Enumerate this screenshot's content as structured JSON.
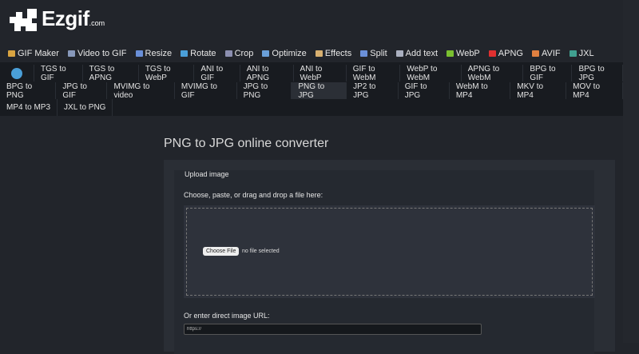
{
  "logo": {
    "name": "Ezgif",
    "suffix": ".com"
  },
  "topnav": [
    {
      "label": "GIF Maker",
      "icon": "gif-maker-icon",
      "color": "#d9a441"
    },
    {
      "label": "Video to GIF",
      "icon": "video-icon",
      "color": "#8899bb"
    },
    {
      "label": "Resize",
      "icon": "resize-icon",
      "color": "#6a8fd8"
    },
    {
      "label": "Rotate",
      "icon": "rotate-icon",
      "color": "#4a9fd8"
    },
    {
      "label": "Crop",
      "icon": "crop-icon",
      "color": "#8c8fb0"
    },
    {
      "label": "Optimize",
      "icon": "optimize-icon",
      "color": "#6a9fd8"
    },
    {
      "label": "Effects",
      "icon": "effects-icon",
      "color": "#d8b070"
    },
    {
      "label": "Split",
      "icon": "split-icon",
      "color": "#6a8fd8"
    },
    {
      "label": "Add text",
      "icon": "add-text-icon",
      "color": "#aab0c0"
    },
    {
      "label": "WebP",
      "icon": "webp-icon",
      "color": "#7ac030"
    },
    {
      "label": "APNG",
      "icon": "apng-icon",
      "color": "#e03030"
    },
    {
      "label": "AVIF",
      "icon": "avif-icon",
      "color": "#e08040"
    },
    {
      "label": "JXL",
      "icon": "jxl-icon",
      "color": "#40a090"
    }
  ],
  "subnav": {
    "row1": [
      "TGS to GIF",
      "TGS to APNG",
      "TGS to WebP",
      "ANI to GIF",
      "ANI to APNG",
      "ANI to WebP",
      "GIF to WebM",
      "WebP to WebM",
      "APNG to WebM",
      "BPG to GIF",
      "BPG to JPG"
    ],
    "row2": [
      "BPG to PNG",
      "JPG to GIF",
      "MVIMG to video",
      "MVIMG to GIF",
      "JPG to PNG",
      "PNG to JPG",
      "JP2 to JPG",
      "GIF to JPG",
      "WebM to MP4",
      "MKV to MP4",
      "MOV to MP4"
    ],
    "row3": [
      "MP4 to MP3",
      "JXL to PNG"
    ],
    "selected": "PNG to JPG"
  },
  "main": {
    "title": "PNG to JPG online converter",
    "legend": "Upload image",
    "drop_label": "Choose, paste, or drag and drop a file here:",
    "choose_file": "Choose File",
    "no_file": "no file selected",
    "url_label": "Or enter direct image URL:",
    "url_value": "https://"
  }
}
